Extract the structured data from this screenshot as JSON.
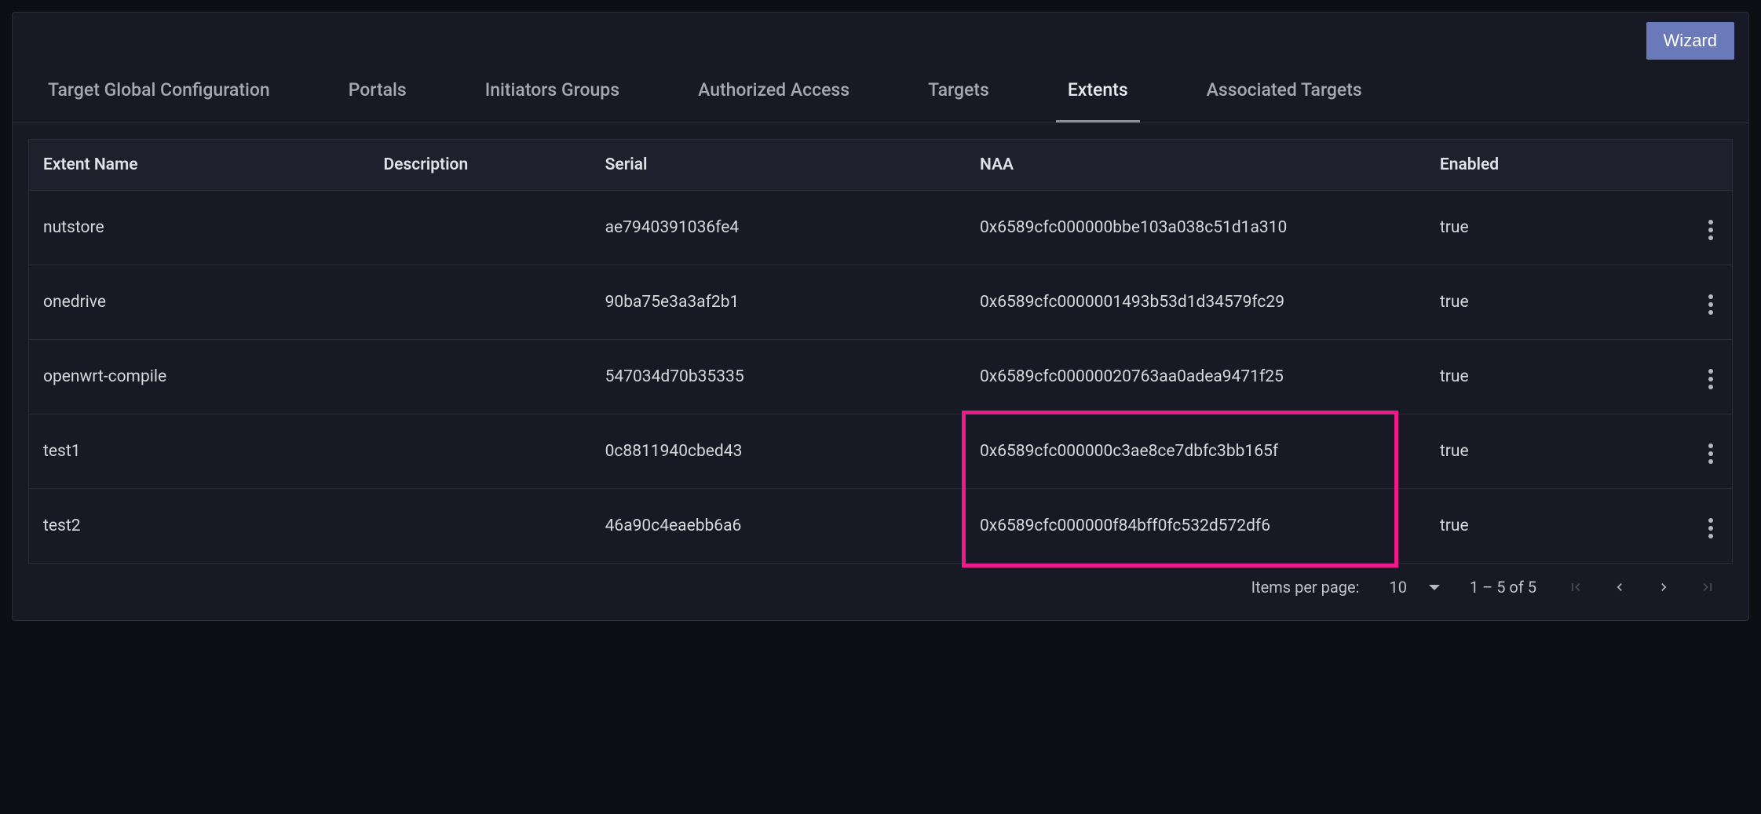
{
  "wizard_label": "Wizard",
  "tabs": [
    {
      "label": "Target Global Configuration",
      "active": false
    },
    {
      "label": "Portals",
      "active": false
    },
    {
      "label": "Initiators Groups",
      "active": false
    },
    {
      "label": "Authorized Access",
      "active": false
    },
    {
      "label": "Targets",
      "active": false
    },
    {
      "label": "Extents",
      "active": true
    },
    {
      "label": "Associated Targets",
      "active": false
    }
  ],
  "table": {
    "headers": {
      "name": "Extent Name",
      "description": "Description",
      "serial": "Serial",
      "naa": "NAA",
      "enabled": "Enabled"
    },
    "rows": [
      {
        "name": "nutstore",
        "description": "",
        "serial": "ae7940391036fe4",
        "naa": "0x6589cfc000000bbe103a038c51d1a310",
        "enabled": "true"
      },
      {
        "name": "onedrive",
        "description": "",
        "serial": "90ba75e3a3af2b1",
        "naa": "0x6589cfc0000001493b53d1d34579fc29",
        "enabled": "true"
      },
      {
        "name": "openwrt-compile",
        "description": "",
        "serial": "547034d70b35335",
        "naa": "0x6589cfc00000020763aa0adea9471f25",
        "enabled": "true"
      },
      {
        "name": "test1",
        "description": "",
        "serial": "0c8811940cbed43",
        "naa": "0x6589cfc000000c3ae8ce7dbfc3bb165f",
        "enabled": "true"
      },
      {
        "name": "test2",
        "description": "",
        "serial": "46a90c4eaebb6a6",
        "naa": "0x6589cfc000000f84bff0fc532d572df6",
        "enabled": "true"
      }
    ]
  },
  "paginator": {
    "items_per_page_label": "Items per page:",
    "page_size": "10",
    "range_label": "1 – 5 of 5"
  },
  "highlight": {
    "row_start": 3,
    "row_end": 4
  }
}
